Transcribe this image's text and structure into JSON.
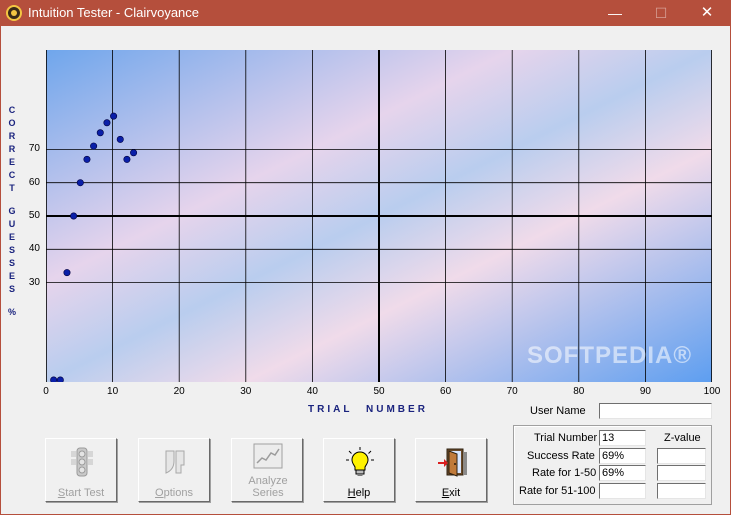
{
  "window": {
    "title": "Intuition Tester - Clairvoyance",
    "min_glyph": "—",
    "max_glyph": "☐",
    "close_glyph": "✕"
  },
  "watermark": "SOFTPEDIA®",
  "chart_data": {
    "type": "scatter",
    "xlabel": "TRIAL NUMBER",
    "ylabel": "CORRECT GUESSES %",
    "xlim": [
      0,
      100
    ],
    "ylim": [
      0,
      100
    ],
    "x_ticks": [
      0,
      10,
      20,
      30,
      40,
      50,
      60,
      70,
      80,
      90,
      100
    ],
    "y_ticks": [
      30,
      40,
      50,
      60,
      70
    ],
    "grid": true,
    "emphasized_lines": {
      "x": 50,
      "y": 50
    },
    "marker_color": "#0a1fa8",
    "series": [
      {
        "x": [
          1,
          2,
          3,
          4,
          5,
          6,
          7,
          8,
          9,
          10,
          11,
          12,
          13
        ],
        "y": [
          0,
          0,
          33,
          50,
          60,
          67,
          71,
          75,
          78,
          80,
          73,
          67,
          69
        ]
      }
    ]
  },
  "buttons": [
    {
      "label": "Start Test",
      "accel": "S",
      "icon": "traffic-light-icon",
      "enabled": false
    },
    {
      "label": "Options",
      "accel": "O",
      "icon": "options-icon",
      "enabled": false
    },
    {
      "label": "Analyze Series",
      "accel": "",
      "icon": "chart-icon",
      "enabled": false
    },
    {
      "label": "Help",
      "accel": "H",
      "icon": "lightbulb-icon",
      "enabled": true
    },
    {
      "label": "Exit",
      "accel": "E",
      "icon": "exit-door-icon",
      "enabled": true
    }
  ],
  "user": {
    "label": "User Name",
    "value": ""
  },
  "stats": {
    "trial_number_label": "Trial Number",
    "trial_number": "13",
    "zvalue_label": "Z-value",
    "success_rate_label": "Success Rate",
    "success_rate": "69%",
    "rate_1_50_label": "Rate for 1-50",
    "rate_1_50": "69%",
    "rate_51_100_label": "Rate for 51-100",
    "rate_51_100": "",
    "z_success": "",
    "z_1_50": "",
    "z_51_100": ""
  }
}
